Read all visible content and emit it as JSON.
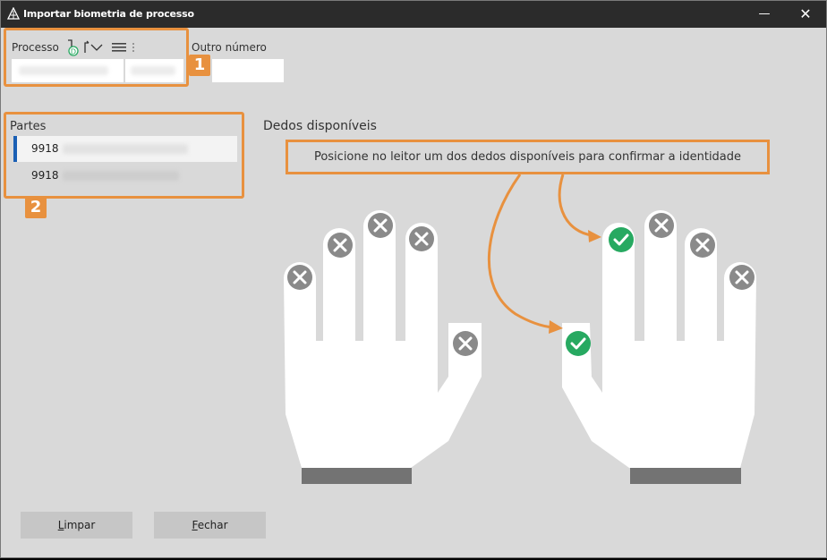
{
  "window": {
    "title": "Importar biometria de processo",
    "minimize_label": "—",
    "close_label": "✕"
  },
  "processo": {
    "label": "Processo",
    "icon_badge": "D",
    "outro_numero_label": "Outro número",
    "badge": "1"
  },
  "partes": {
    "label": "Partes",
    "badge": "2",
    "items": [
      {
        "num": "9918"
      },
      {
        "num": "9918"
      }
    ]
  },
  "dedos": {
    "label": "Dedos disponíveis",
    "instruction": "Posicione no leitor um dos dedos disponíveis para confirmar a identidade"
  },
  "buttons": {
    "limpar_underline": "L",
    "limpar_rest": "impar",
    "fechar_underline": "F",
    "fechar_rest": "echar"
  },
  "colors": {
    "accent": "#e8913f",
    "selected": "#1a5fb4",
    "check": "#27a961",
    "unavailable": "#8a8a8a"
  }
}
